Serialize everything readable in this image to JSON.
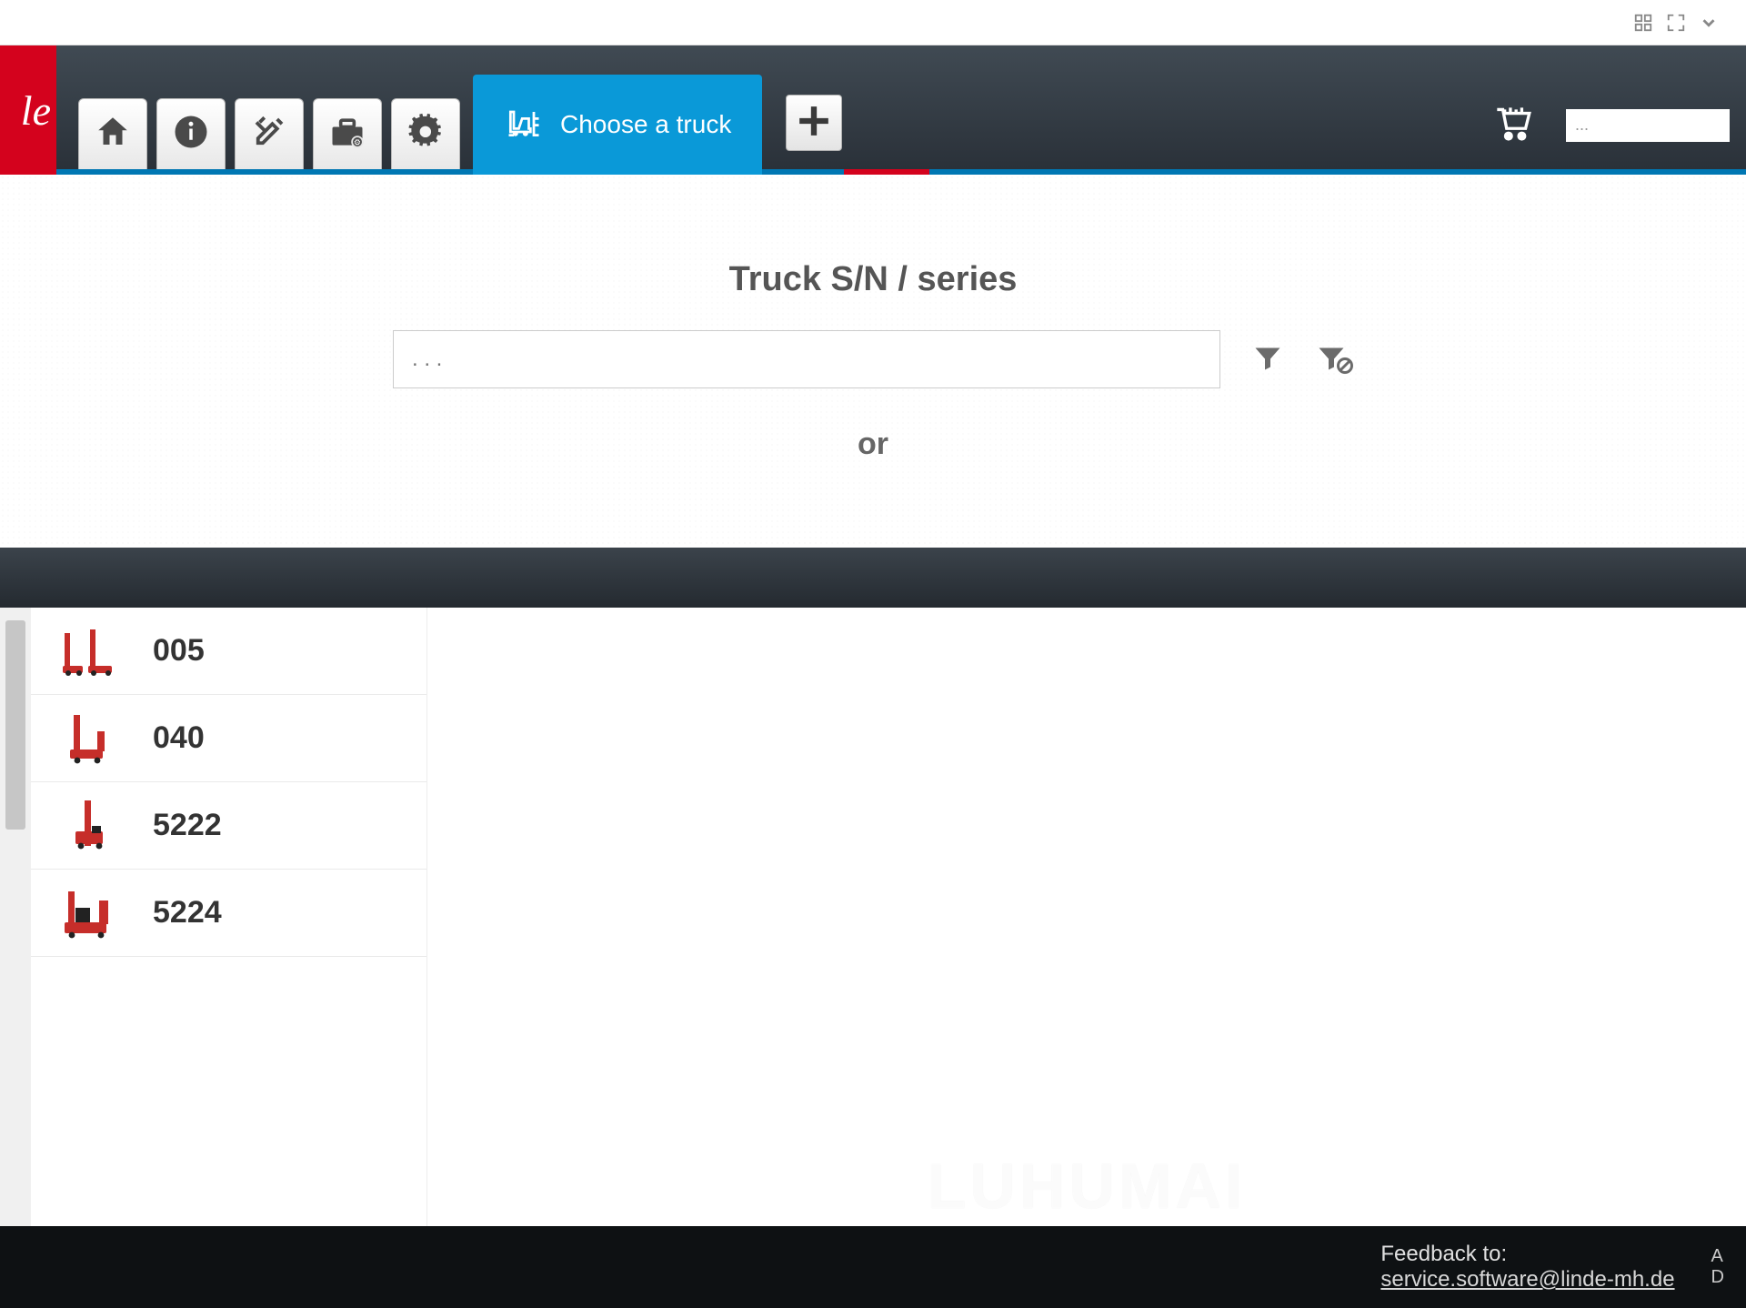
{
  "header": {
    "logo_fragment": "le",
    "active_tab_label": "Choose a truck",
    "search_placeholder": "...",
    "nav_icons": [
      "home",
      "info",
      "tools",
      "toolbox",
      "settings"
    ]
  },
  "search": {
    "title": "Truck S/N / series",
    "input_placeholder": ". . .",
    "or_label": "or"
  },
  "sidebar": {
    "items": [
      {
        "label": "005"
      },
      {
        "label": "040"
      },
      {
        "label": "5222"
      },
      {
        "label": "5224"
      }
    ]
  },
  "watermark": "LUHUMAI",
  "footer": {
    "feedback_label": "Feedback to:",
    "feedback_email": "service.software@linde-mh.de",
    "right_edge_top": "A",
    "right_edge_bottom": "D"
  }
}
